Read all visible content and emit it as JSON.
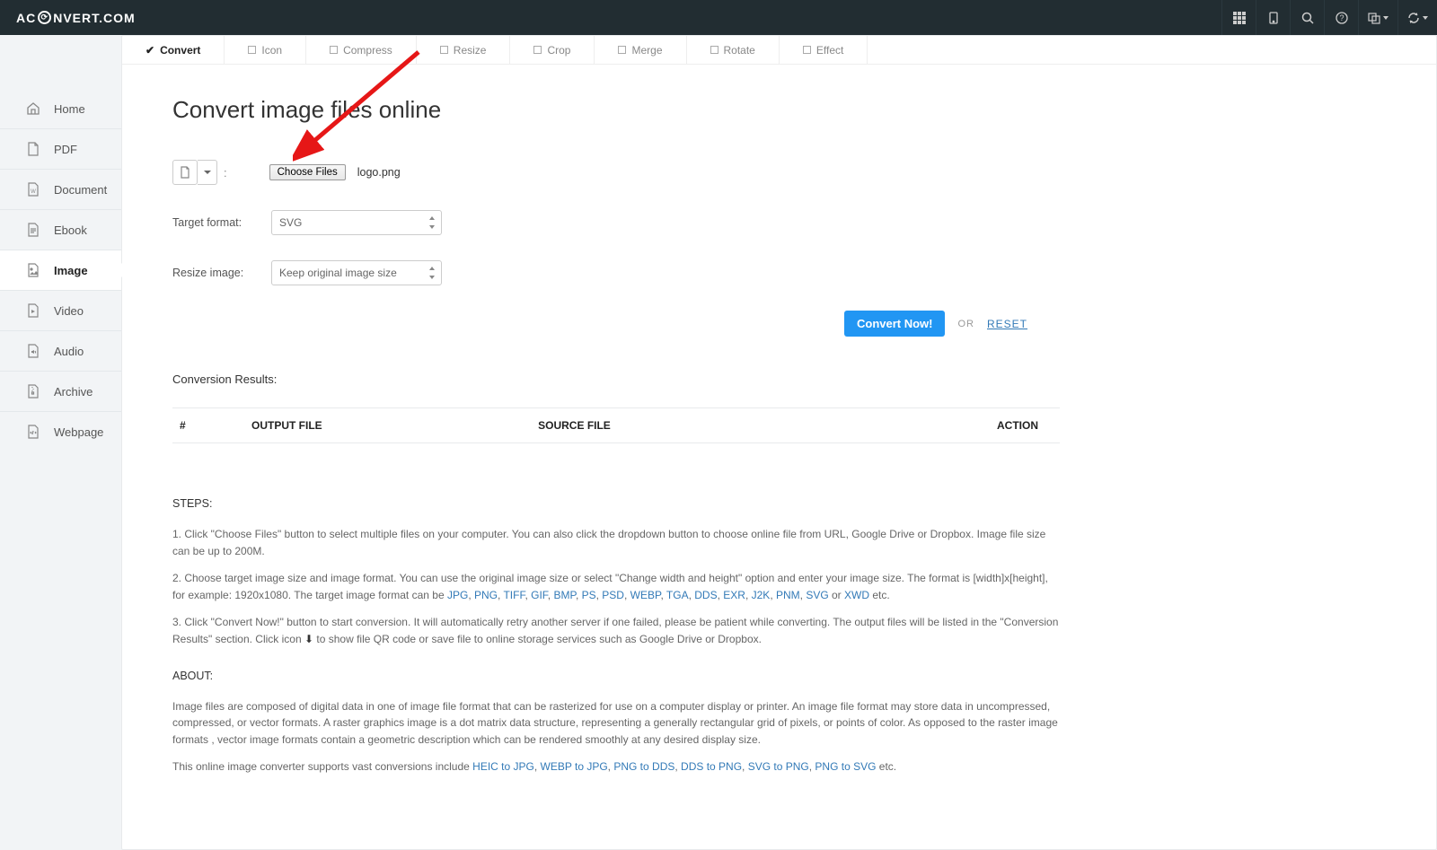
{
  "brand": {
    "prefix": "AC",
    "suffix": "NVERT.COM"
  },
  "nav_icons": [
    "grid-icon",
    "mobile-icon",
    "search-icon",
    "help-icon",
    "language-icon",
    "refresh-icon"
  ],
  "sidebar": {
    "items": [
      {
        "label": "Home",
        "icon": "home"
      },
      {
        "label": "PDF",
        "icon": "file"
      },
      {
        "label": "Document",
        "icon": "file-word"
      },
      {
        "label": "Ebook",
        "icon": "file-text"
      },
      {
        "label": "Image",
        "icon": "file-image",
        "active": true
      },
      {
        "label": "Video",
        "icon": "file-video"
      },
      {
        "label": "Audio",
        "icon": "file-audio"
      },
      {
        "label": "Archive",
        "icon": "file-archive"
      },
      {
        "label": "Webpage",
        "icon": "file-code"
      }
    ]
  },
  "tabs": [
    {
      "label": "Convert",
      "active": true
    },
    {
      "label": "Icon"
    },
    {
      "label": "Compress"
    },
    {
      "label": "Resize"
    },
    {
      "label": "Crop"
    },
    {
      "label": "Merge"
    },
    {
      "label": "Rotate"
    },
    {
      "label": "Effect"
    }
  ],
  "page": {
    "title": "Convert image files online",
    "choose_files": "Choose Files",
    "filename": "logo.png",
    "labels": {
      "target": "Target format:",
      "resize": "Resize image:"
    },
    "target_value": "SVG",
    "resize_value": "Keep original image size",
    "convert_btn": "Convert Now!",
    "or": "OR",
    "reset": "RESET",
    "results_title": "Conversion Results:",
    "cols": {
      "num": "#",
      "output": "OUTPUT FILE",
      "source": "SOURCE FILE",
      "action": "ACTION"
    },
    "steps_title": "STEPS:",
    "step1": "1. Click \"Choose Files\" button to select multiple files on your computer. You can also click the dropdown button to choose online file from URL, Google Drive or Dropbox. Image file size can be up to 200M.",
    "step2a": "2. Choose target image size and image format. You can use the original image size or select \"Change width and height\" option and enter your image size. The format is [width]x[height], for example: 1920x1080. The target image format can be ",
    "formats": [
      "JPG",
      "PNG",
      "TIFF",
      "GIF",
      "BMP",
      "PS",
      "PSD",
      "WEBP",
      "TGA",
      "DDS",
      "EXR",
      "J2K",
      "PNM",
      "SVG"
    ],
    "or_word": " or ",
    "last_format": "XWD",
    "step2b": " etc.",
    "step3a": "3. Click \"Convert Now!\" button to start conversion. It will automatically retry another server if one failed, please be patient while converting. The output files will be listed in the \"Conversion Results\" section. Click icon ",
    "step3b": " to show file QR code or save file to online storage services such as Google Drive or Dropbox.",
    "about_title": "ABOUT:",
    "about1": "Image files are composed of digital data in one of image file format that can be rasterized for use on a computer display or printer. An image file format may store data in uncompressed, compressed, or vector formats. A raster graphics image is a dot matrix data structure, representing a generally rectangular grid of pixels, or points of color. As opposed to the raster image formats , vector image formats contain a geometric description which can be rendered smoothly at any desired display size.",
    "about2a": "This online image converter supports vast conversions include ",
    "conv_links": [
      "HEIC to JPG",
      "WEBP to JPG",
      "PNG to DDS",
      "DDS to PNG",
      "SVG to PNG",
      "PNG to SVG"
    ],
    "about2b": " etc."
  }
}
